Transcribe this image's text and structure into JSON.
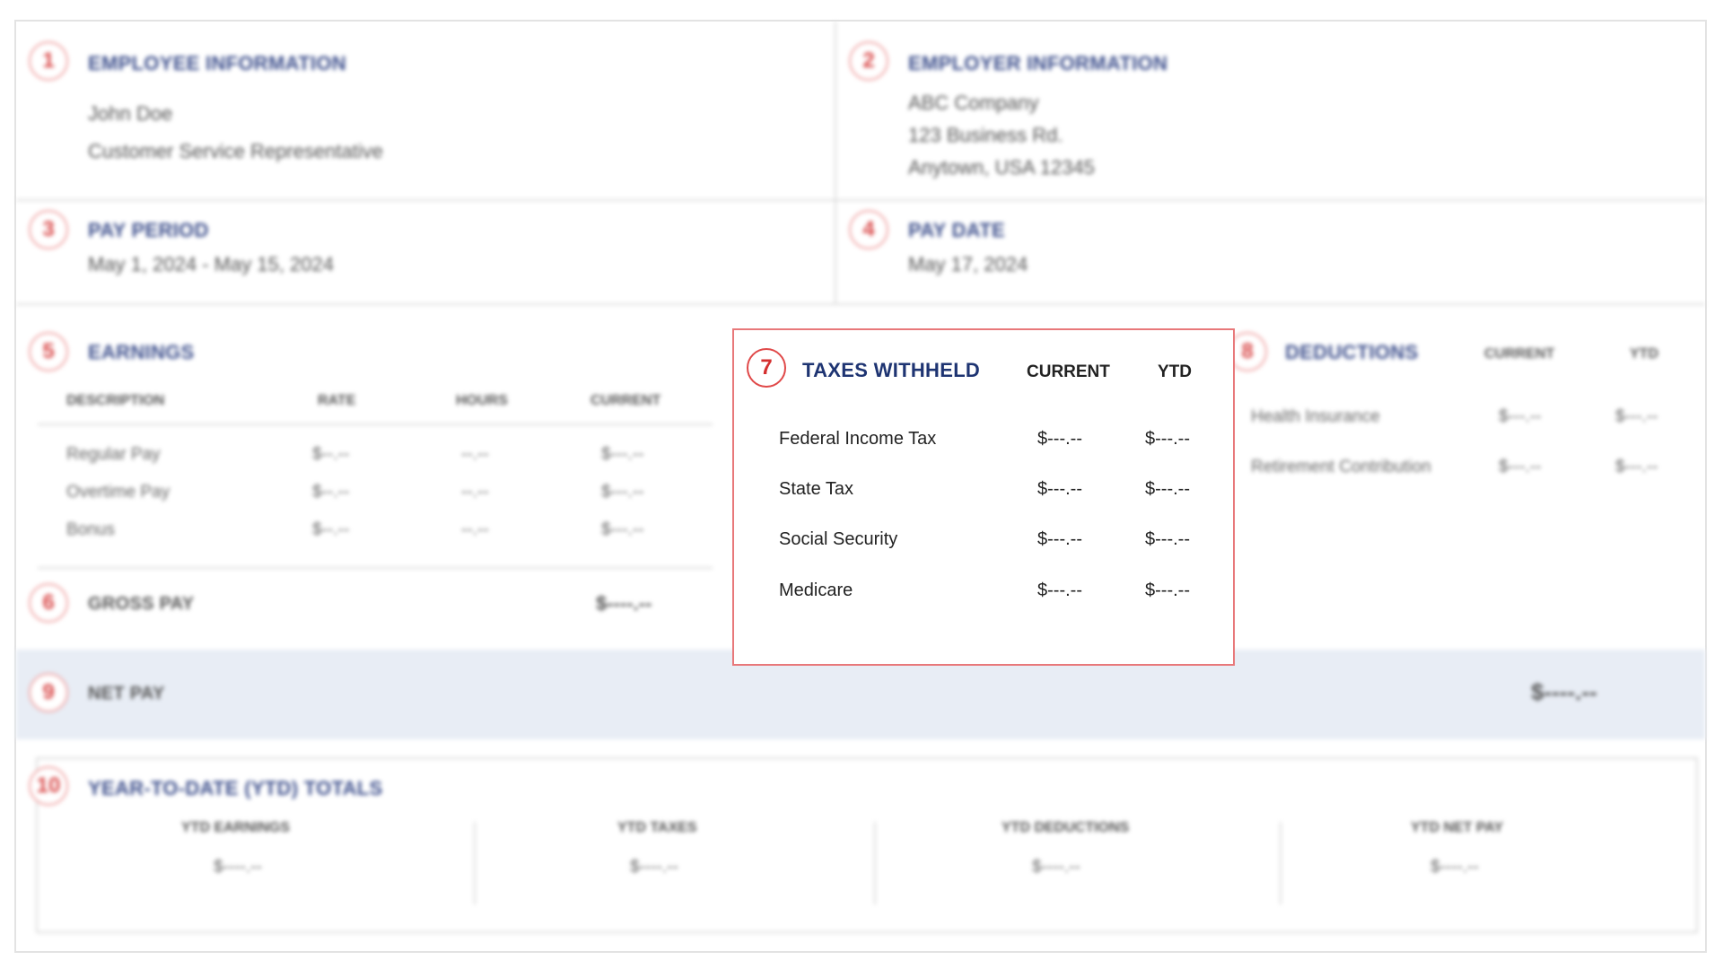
{
  "employee": {
    "badge": "1",
    "title": "EMPLOYEE INFORMATION",
    "name": "John Doe",
    "position": "Customer Service Representative"
  },
  "employer": {
    "badge": "2",
    "title": "EMPLOYER INFORMATION",
    "company": "ABC Company",
    "address1": "123 Business Rd.",
    "address2": "Anytown, USA 12345"
  },
  "pay_period": {
    "badge": "3",
    "title": "PAY PERIOD",
    "value": "May 1, 2024 - May 15, 2024"
  },
  "pay_date": {
    "badge": "4",
    "title": "PAY DATE",
    "value": "May 17, 2024"
  },
  "earnings": {
    "badge": "5",
    "title": "EARNINGS",
    "headers": {
      "description": "DESCRIPTION",
      "rate": "RATE",
      "hours": "HOURS",
      "current": "CURRENT"
    },
    "rows": [
      {
        "description": "Regular Pay",
        "rate": "$--.--",
        "hours": "--.--",
        "current": "$---.--"
      },
      {
        "description": "Overtime Pay",
        "rate": "$--.--",
        "hours": "--.--",
        "current": "$---.--"
      },
      {
        "description": "Bonus",
        "rate": "$--.--",
        "hours": "--.--",
        "current": "$---.--"
      }
    ]
  },
  "gross_pay": {
    "badge": "6",
    "title": "GROSS PAY",
    "value": "$----.--"
  },
  "taxes": {
    "badge": "7",
    "title": "TAXES WITHHELD",
    "headers": {
      "current": "CURRENT",
      "ytd": "YTD"
    },
    "rows": [
      {
        "label": "Federal Income Tax",
        "current": "$---.--",
        "ytd": "$---.--"
      },
      {
        "label": "State Tax",
        "current": "$---.--",
        "ytd": "$---.--"
      },
      {
        "label": "Social Security",
        "current": "$---.--",
        "ytd": "$---.--"
      },
      {
        "label": "Medicare",
        "current": "$---.--",
        "ytd": "$---.--"
      }
    ]
  },
  "deductions": {
    "badge": "8",
    "title": "DEDUCTIONS",
    "headers": {
      "current": "CURRENT",
      "ytd": "YTD"
    },
    "rows": [
      {
        "label": "Health Insurance",
        "current": "$---.--",
        "ytd": "$---.--"
      },
      {
        "label": "Retirement Contribution",
        "current": "$---.--",
        "ytd": "$---.--"
      }
    ]
  },
  "net_pay": {
    "badge": "9",
    "title": "NET PAY",
    "value": "$----.--"
  },
  "ytd_totals": {
    "badge": "10",
    "title": "YEAR-TO-DATE (YTD) TOTALS",
    "columns": [
      {
        "label": "YTD EARNINGS",
        "value": "$----.--"
      },
      {
        "label": "YTD TAXES",
        "value": "$----.--"
      },
      {
        "label": "YTD DEDUCTIONS",
        "value": "$----.--"
      },
      {
        "label": "YTD NET PAY",
        "value": "$----.--"
      }
    ]
  },
  "colors": {
    "title_blue": "#3d4f8c",
    "badge_red": "#d94a4a",
    "highlight_border": "#e8787a",
    "net_pay_band": "#e8edf5"
  }
}
